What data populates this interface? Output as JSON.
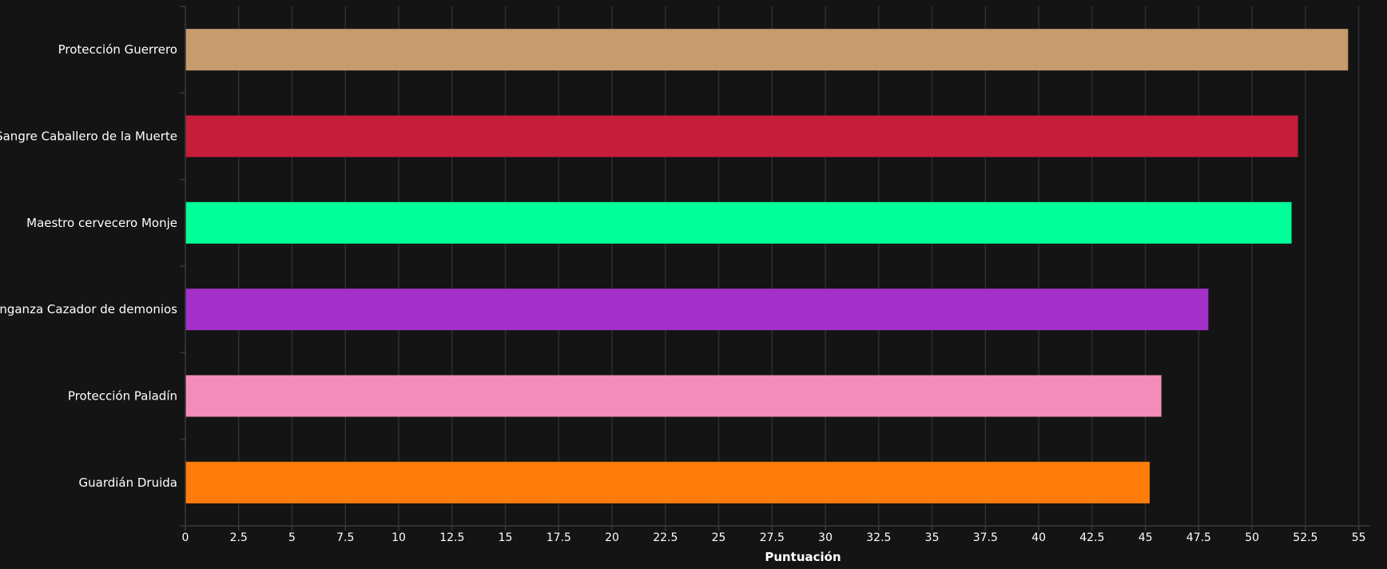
{
  "chart_data": {
    "type": "bar",
    "orientation": "horizontal",
    "categories": [
      "Protección Guerrero",
      "Sangre Caballero de la Muerte",
      "Maestro cervecero Monje",
      "Venganza Cazador de demonios",
      "Protección Paladín",
      "Guardián Druida"
    ],
    "values": [
      54.5,
      52.15,
      51.85,
      47.95,
      45.75,
      45.2
    ],
    "colors": [
      "#c69b6d",
      "#c41e3a",
      "#00ff98",
      "#a330c9",
      "#f48cba",
      "#ff7c0a"
    ],
    "xlabel": "Puntuación",
    "ylabel": "",
    "xlim": [
      0,
      55.5
    ],
    "xticks": [
      0,
      2.5,
      5,
      7.5,
      10,
      12.5,
      15,
      17.5,
      20,
      22.5,
      25,
      27.5,
      30,
      32.5,
      35,
      37.5,
      40,
      42.5,
      45,
      47.5,
      50,
      52.5,
      55
    ],
    "xtick_labels": [
      "0",
      "2.5",
      "5",
      "7.5",
      "10",
      "12.5",
      "15",
      "17.5",
      "20",
      "22.5",
      "25",
      "27.5",
      "30",
      "32.5",
      "35",
      "37.5",
      "40",
      "42.5",
      "45",
      "47.5",
      "50",
      "52.5",
      "55"
    ],
    "grid": true,
    "background": "#141414"
  }
}
